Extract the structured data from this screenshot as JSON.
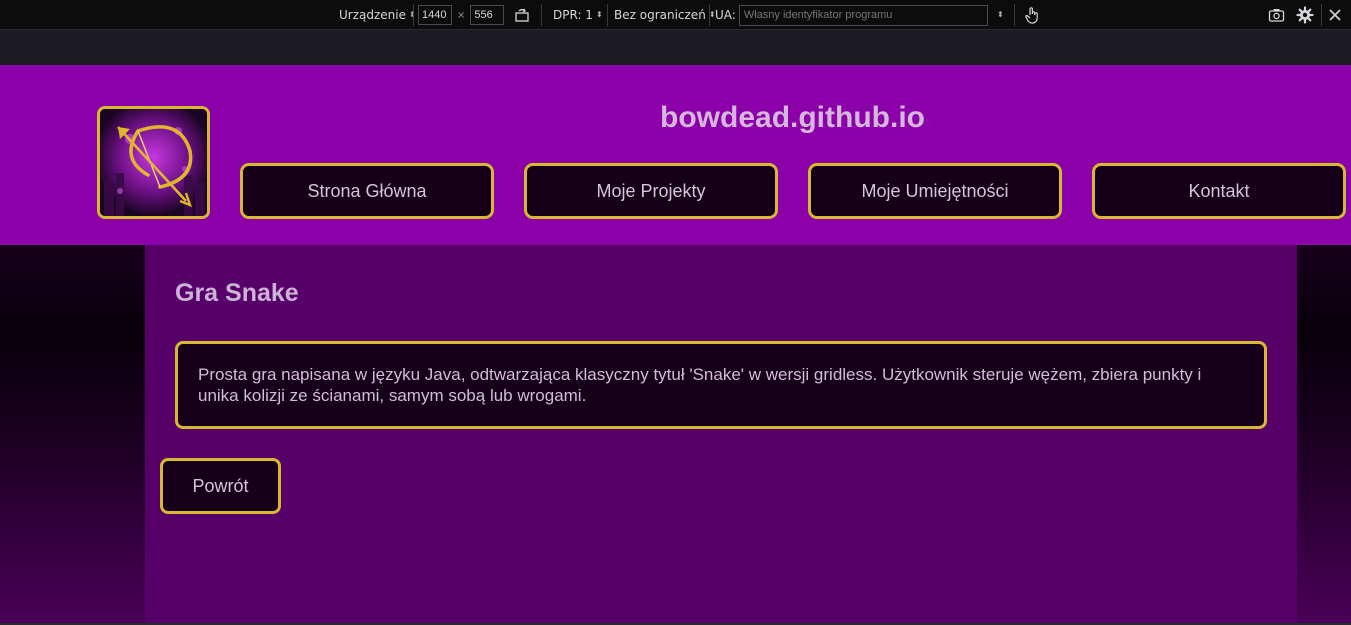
{
  "devtools": {
    "device_label": "Urządzenie",
    "width_value": "1440",
    "times": "×",
    "height_value": "556",
    "dpr_label": "DPR: 1",
    "throttle_label": "Bez ograniczeń",
    "ua_label": "UA:",
    "ua_placeholder": "Własny identyfikator programu",
    "icons": [
      "rotate-icon",
      "touch-icon",
      "screenshot-icon",
      "settings-icon",
      "close-icon"
    ]
  },
  "site": {
    "title": "bowdead.github.io",
    "logo_icon": "bow-and-arrow-logo",
    "nav": [
      {
        "label": "Strona Główna"
      },
      {
        "label": "Moje Projekty"
      },
      {
        "label": "Moje Umiejętności"
      },
      {
        "label": "Kontakt"
      }
    ]
  },
  "project": {
    "title": "Gra Snake",
    "description": "Prosta gra napisana w języku Java, odtwarzająca klasyczny tytuł 'Snake' w wersji gridless. Użytkownik steruje wężem, zbiera punkty i unika kolizji ze ścianami, samym sobą lub wrogami.",
    "back_label": "Powrót"
  },
  "colors": {
    "header_bg": "#8b00a8",
    "content_bg": "#57006a",
    "accent_border": "#d6b92e",
    "button_bg": "#150018",
    "text": "#d6c5da"
  }
}
